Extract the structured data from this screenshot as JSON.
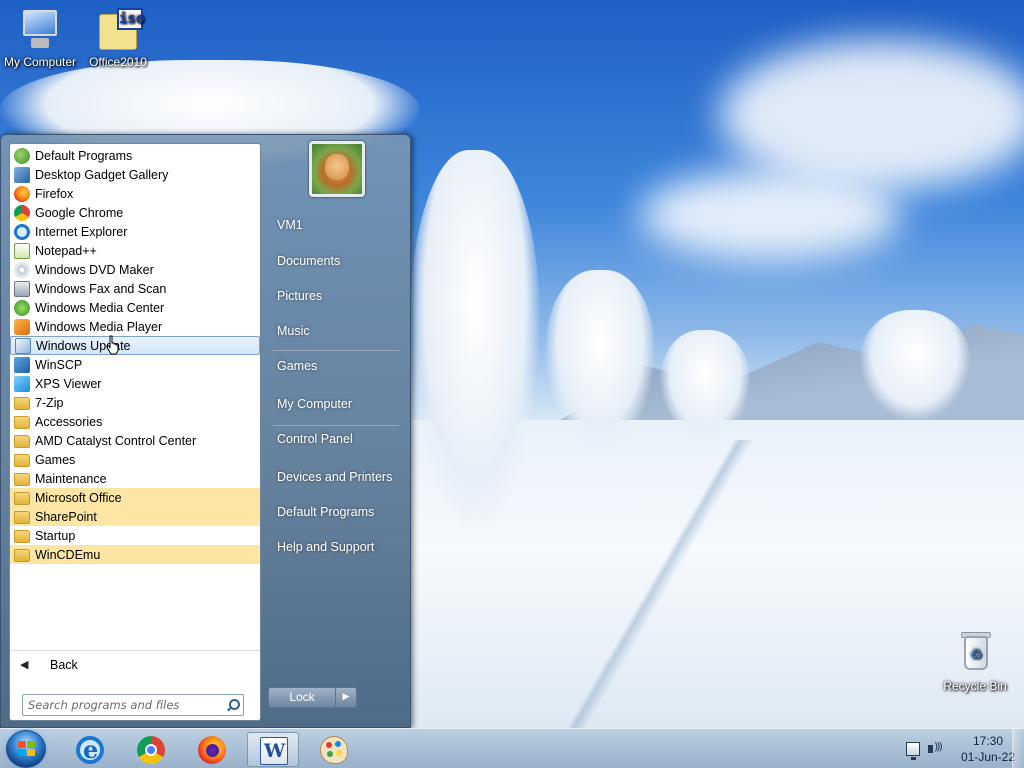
{
  "desktop": {
    "icons": [
      {
        "label": "My Computer",
        "icon": "computer-icon"
      },
      {
        "label": "Office2010",
        "icon": "iso-file-icon",
        "badge": "iso"
      },
      {
        "label": "Recycle Bin",
        "icon": "recycle-bin-icon"
      }
    ]
  },
  "start_menu": {
    "programs": [
      {
        "label": "Default Programs",
        "icon": "default-programs-icon"
      },
      {
        "label": "Desktop Gadget Gallery",
        "icon": "gadget-gallery-icon"
      },
      {
        "label": "Firefox",
        "icon": "firefox-icon"
      },
      {
        "label": "Google Chrome",
        "icon": "chrome-icon"
      },
      {
        "label": "Internet Explorer",
        "icon": "internet-explorer-icon"
      },
      {
        "label": "Notepad++",
        "icon": "notepad-plus-plus-icon"
      },
      {
        "label": "Windows DVD Maker",
        "icon": "dvd-maker-icon"
      },
      {
        "label": "Windows Fax and Scan",
        "icon": "fax-scan-icon"
      },
      {
        "label": "Windows Media Center",
        "icon": "media-center-icon"
      },
      {
        "label": "Windows Media Player",
        "icon": "media-player-icon"
      },
      {
        "label": "Windows Update",
        "icon": "windows-update-icon",
        "state": "hover"
      },
      {
        "label": "WinSCP",
        "icon": "winscp-icon"
      },
      {
        "label": "XPS Viewer",
        "icon": "xps-viewer-icon"
      },
      {
        "label": "7-Zip",
        "icon": "folder-icon"
      },
      {
        "label": "Accessories",
        "icon": "folder-icon"
      },
      {
        "label": "AMD Catalyst Control Center",
        "icon": "folder-icon"
      },
      {
        "label": "Games",
        "icon": "folder-icon"
      },
      {
        "label": "Maintenance",
        "icon": "folder-icon"
      },
      {
        "label": "Microsoft Office",
        "icon": "folder-icon",
        "state": "new"
      },
      {
        "label": "SharePoint",
        "icon": "folder-icon",
        "state": "new"
      },
      {
        "label": "Startup",
        "icon": "folder-icon"
      },
      {
        "label": "WinCDEmu",
        "icon": "folder-icon",
        "state": "new"
      }
    ],
    "back_label": "Back",
    "search_placeholder": "Search programs and files",
    "user_name": "VM1",
    "right_items": [
      "Documents",
      "Pictures",
      "Music",
      "Games",
      "My Computer",
      "Control Panel",
      "Devices and Printers",
      "Default Programs",
      "Help and Support"
    ],
    "lock_label": "Lock"
  },
  "taskbar": {
    "pinned": [
      {
        "name": "internet-explorer",
        "icon": "internet-explorer-icon"
      },
      {
        "name": "google-chrome",
        "icon": "chrome-icon"
      },
      {
        "name": "firefox",
        "icon": "firefox-icon"
      },
      {
        "name": "microsoft-word",
        "icon": "word-icon",
        "state": "active"
      },
      {
        "name": "paint",
        "icon": "paint-icon"
      }
    ],
    "clock_time": "17:30",
    "clock_date": "01-Jun-22"
  },
  "colors": {
    "highlight_new": "#fde6a4",
    "start_menu_right": "#6f86a0",
    "taskbar": "#a9bfd6"
  }
}
